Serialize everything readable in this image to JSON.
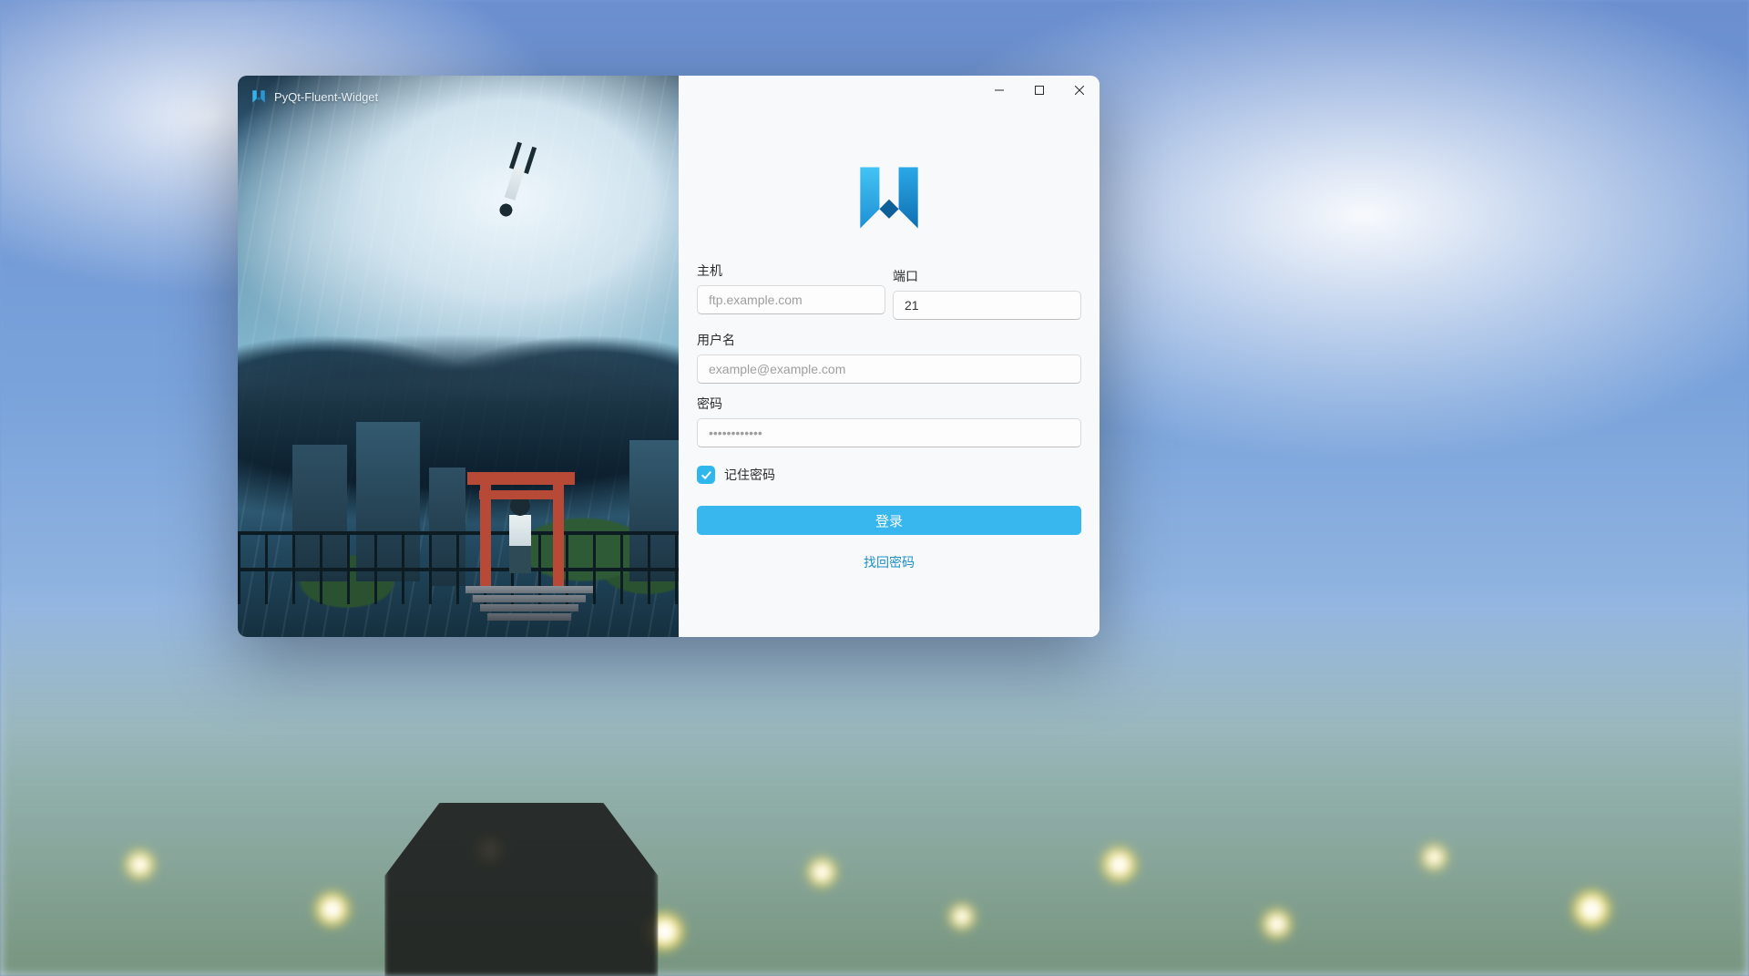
{
  "app": {
    "title": "PyQt-Fluent-Widget"
  },
  "form": {
    "host_label": "主机",
    "host_placeholder": "ftp.example.com",
    "host_value": "",
    "port_label": "端口",
    "port_value": "21",
    "user_label": "用户名",
    "user_placeholder": "example@example.com",
    "user_value": "",
    "password_label": "密码",
    "password_placeholder": "••••••••••••",
    "password_value": "",
    "remember_label": "记住密码",
    "remember_checked": true,
    "login_label": "登录",
    "forgot_label": "找回密码"
  },
  "colors": {
    "accent": "#37b7ed",
    "link": "#1f8fc5"
  }
}
